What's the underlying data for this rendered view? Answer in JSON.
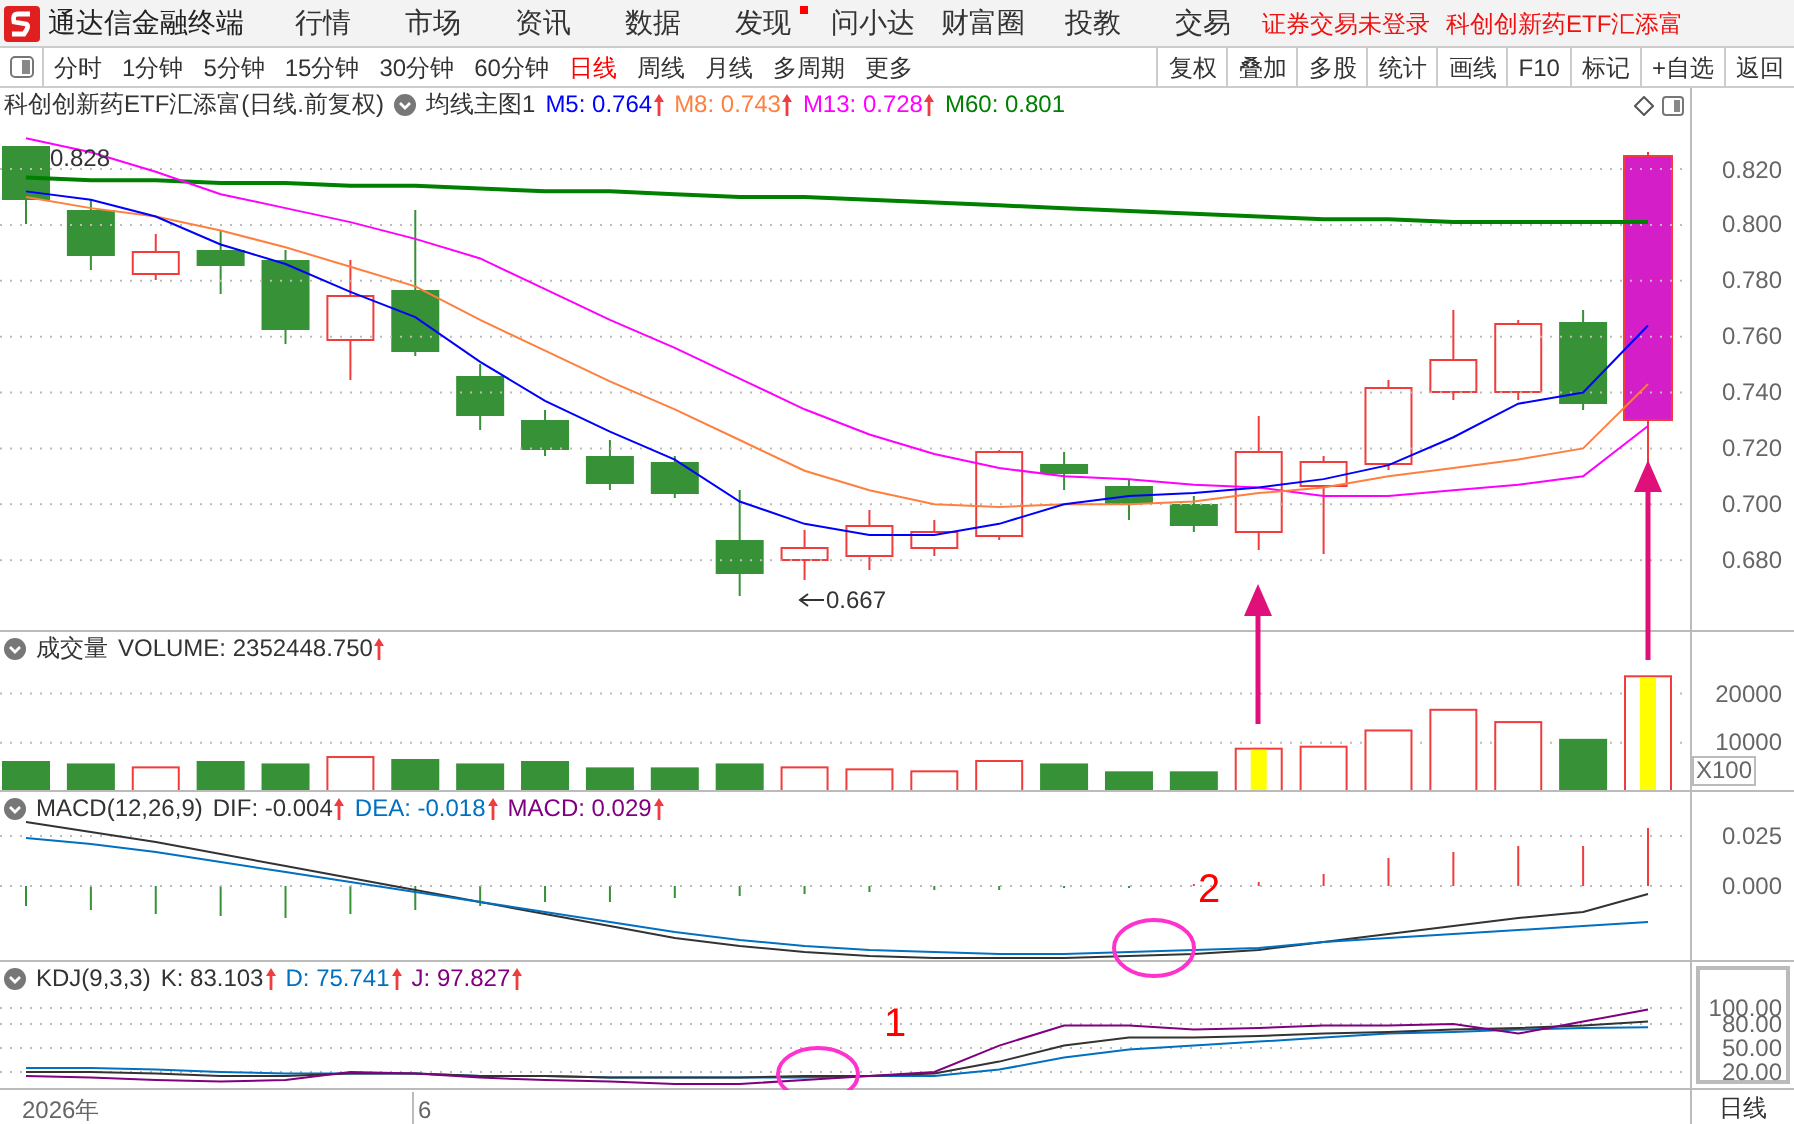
{
  "app": {
    "name": "通达信金融终端"
  },
  "menu": [
    {
      "label": "行情",
      "dot": false
    },
    {
      "label": "市场",
      "dot": false
    },
    {
      "label": "资讯",
      "dot": false
    },
    {
      "label": "数据",
      "dot": false
    },
    {
      "label": "发现",
      "dot": true
    },
    {
      "label": "问小达",
      "dot": false
    },
    {
      "label": "财富圈",
      "dot": false
    },
    {
      "label": "投教",
      "dot": false
    },
    {
      "label": "交易",
      "dot": false
    }
  ],
  "notices": [
    "证券交易未登录",
    "科创创新药ETF汇添富"
  ],
  "periods": [
    {
      "label": "分时",
      "selected": false
    },
    {
      "label": "1分钟",
      "selected": false
    },
    {
      "label": "5分钟",
      "selected": false
    },
    {
      "label": "15分钟",
      "selected": false
    },
    {
      "label": "30分钟",
      "selected": false
    },
    {
      "label": "60分钟",
      "selected": false
    },
    {
      "label": "日线",
      "selected": true
    },
    {
      "label": "周线",
      "selected": false
    },
    {
      "label": "月线",
      "selected": false
    },
    {
      "label": "多周期",
      "selected": false
    },
    {
      "label": "更多",
      "selected": false
    }
  ],
  "tools": [
    "复权",
    "叠加",
    "多股",
    "统计",
    "画线",
    "F10",
    "标记",
    "+自选",
    "返回"
  ],
  "main_panel": {
    "title": "科创创新药ETF汇添富(日线.前复权)",
    "indicator": "均线主图1",
    "values": [
      {
        "text": "M5: 0.764",
        "color": "#0000ff",
        "arrow": true
      },
      {
        "text": "M8: 0.743",
        "color": "#ff7f3f",
        "arrow": true
      },
      {
        "text": "M13: 0.728",
        "color": "#ff00ff",
        "arrow": true
      },
      {
        "text": "M60: 0.801",
        "color": "#008000",
        "arrow": false
      }
    ],
    "high_label": "0.828",
    "low_label": "0.667",
    "chart_data": {
      "type": "line",
      "grid": true,
      "ylim": [
        0.655,
        0.849
      ],
      "yticks": [
        {
          "value": 0.82,
          "label": "0.820"
        },
        {
          "value": 0.8,
          "label": "0.800"
        },
        {
          "value": 0.78,
          "label": "0.780"
        },
        {
          "value": 0.76,
          "label": "0.760"
        },
        {
          "value": 0.74,
          "label": "0.740"
        },
        {
          "value": 0.72,
          "label": "0.720"
        },
        {
          "value": 0.7,
          "label": "0.700"
        },
        {
          "value": 0.68,
          "label": "0.680"
        }
      ],
      "series": [
        {
          "color": "#008000",
          "values": [
            0.817,
            0.816,
            0.816,
            0.815,
            0.815,
            0.814,
            0.814,
            0.813,
            0.812,
            0.812,
            0.811,
            0.81,
            0.81,
            0.809,
            0.808,
            0.807,
            0.806,
            0.805,
            0.804,
            0.803,
            0.802,
            0.802,
            0.801,
            0.801,
            0.801,
            0.801
          ]
        },
        {
          "color": "#ff00ff",
          "values": [
            0.831,
            0.826,
            0.819,
            0.811,
            0.806,
            0.801,
            0.795,
            0.788,
            0.777,
            0.766,
            0.756,
            0.745,
            0.734,
            0.725,
            0.718,
            0.713,
            0.71,
            0.709,
            0.707,
            0.706,
            0.703,
            0.703,
            0.705,
            0.707,
            0.71,
            0.728
          ]
        },
        {
          "color": "#ff7f3f",
          "values": [
            0.81,
            0.806,
            0.803,
            0.798,
            0.792,
            0.785,
            0.778,
            0.766,
            0.755,
            0.744,
            0.734,
            0.723,
            0.712,
            0.705,
            0.7,
            0.699,
            0.7,
            0.7,
            0.701,
            0.704,
            0.706,
            0.71,
            0.713,
            0.716,
            0.72,
            0.743
          ]
        },
        {
          "color": "#0000ff",
          "values": [
            0.812,
            0.809,
            0.803,
            0.793,
            0.786,
            0.776,
            0.767,
            0.751,
            0.737,
            0.726,
            0.716,
            0.701,
            0.693,
            0.689,
            0.689,
            0.693,
            0.7,
            0.703,
            0.704,
            0.706,
            0.709,
            0.714,
            0.724,
            0.736,
            0.74,
            0.764
          ]
        }
      ]
    }
  },
  "volume_panel": {
    "name": "成交量",
    "values": [
      {
        "text": "VOLUME: 2352448.750",
        "color": "#333333",
        "arrow": true
      }
    ],
    "unit": "X100",
    "chart_data": {
      "type": "bar",
      "grid": true,
      "ylim": [
        0,
        32500
      ],
      "yticks": [
        {
          "value": 20000,
          "label": "20000"
        },
        {
          "value": 10000,
          "label": "10000"
        }
      ],
      "series": [
        {
          "color": "#f03c3c",
          "values": [
            null,
            null,
            5000,
            null,
            null,
            7100,
            null,
            null,
            null,
            null,
            null,
            null,
            5000,
            4600,
            4200,
            6300,
            null,
            null,
            null,
            8800,
            9200,
            12500,
            16700,
            14200,
            null,
            23500
          ]
        },
        {
          "color": "#379137",
          "values": [
            6300,
            5800,
            null,
            6300,
            5800,
            null,
            6700,
            5800,
            6300,
            5000,
            5000,
            5800,
            null,
            null,
            null,
            null,
            5800,
            4200,
            4200,
            null,
            null,
            null,
            null,
            null,
            10800,
            null
          ]
        },
        {
          "color": "#ffff00",
          "values": [
            null,
            null,
            null,
            null,
            null,
            null,
            null,
            null,
            null,
            null,
            null,
            null,
            null,
            null,
            null,
            null,
            null,
            null,
            null,
            8800,
            null,
            null,
            null,
            null,
            null,
            23500
          ]
        }
      ]
    }
  },
  "macd_panel": {
    "name": "MACD(12,26,9)",
    "values": [
      {
        "text": "DIF: -0.004",
        "color": "#333333",
        "arrow": true
      },
      {
        "text": "DEA: -0.018",
        "color": "#0070c0",
        "arrow": true
      },
      {
        "text": "MACD: 0.029",
        "color": "#800080",
        "arrow": true
      }
    ],
    "marker": "2",
    "chart_data": {
      "type": "line",
      "grid": true,
      "ylim": [
        -0.038,
        0.047
      ],
      "yticks": [
        {
          "value": 0.025,
          "label": "0.025"
        },
        {
          "value": 0,
          "label": "0.000"
        }
      ],
      "series": [
        {
          "color": "#333333",
          "values": [
            0.032,
            0.027,
            0.022,
            0.016,
            0.01,
            0.004,
            -0.002,
            -0.008,
            -0.014,
            -0.02,
            -0.026,
            -0.03,
            -0.033,
            -0.035,
            -0.036,
            -0.036,
            -0.036,
            -0.035,
            -0.034,
            -0.032,
            -0.028,
            -0.024,
            -0.02,
            -0.016,
            -0.013,
            -0.004
          ]
        },
        {
          "color": "#0070c0",
          "values": [
            0.024,
            0.021,
            0.017,
            0.012,
            0.007,
            0.002,
            -0.003,
            -0.008,
            -0.013,
            -0.018,
            -0.023,
            -0.027,
            -0.03,
            -0.032,
            -0.033,
            -0.034,
            -0.034,
            -0.033,
            -0.032,
            -0.031,
            -0.028,
            -0.026,
            -0.024,
            -0.022,
            -0.02,
            -0.018
          ]
        }
      ]
    }
  },
  "kdj_panel": {
    "name": "KDJ(9,3,3)",
    "values": [
      {
        "text": "K: 83.103",
        "color": "#333333",
        "arrow": true
      },
      {
        "text": "D: 75.741",
        "color": "#0070c0",
        "arrow": true
      },
      {
        "text": "J: 97.827",
        "color": "#800080",
        "arrow": true
      }
    ],
    "marker": "1",
    "chart_data": {
      "type": "line",
      "grid": true,
      "ylim": [
        -5,
        157.5
      ],
      "yticks": [
        {
          "value": 100,
          "label": "100.00"
        },
        {
          "value": 80,
          "label": "80.00"
        },
        {
          "value": 50,
          "label": "50.00"
        },
        {
          "value": 20,
          "label": "20.00"
        }
      ],
      "series": [
        {
          "color": "#0070c0",
          "values": [
            25,
            25,
            23,
            20,
            18,
            18,
            18,
            15,
            15,
            13,
            13,
            13,
            13,
            15,
            15,
            23,
            38,
            48,
            53,
            58,
            63,
            68,
            70,
            73,
            75,
            76
          ]
        },
        {
          "color": "#333333",
          "values": [
            20,
            20,
            18,
            15,
            15,
            18,
            18,
            15,
            15,
            13,
            13,
            13,
            15,
            15,
            18,
            33,
            53,
            63,
            63,
            65,
            68,
            70,
            73,
            75,
            78,
            83
          ]
        },
        {
          "color": "#800080",
          "values": [
            15,
            13,
            10,
            8,
            10,
            20,
            18,
            13,
            10,
            8,
            5,
            5,
            10,
            15,
            20,
            53,
            78,
            78,
            73,
            75,
            78,
            78,
            80,
            68,
            83,
            98
          ]
        }
      ]
    }
  },
  "date_axis": [
    "2026年",
    "6"
  ],
  "period_label": "日线"
}
